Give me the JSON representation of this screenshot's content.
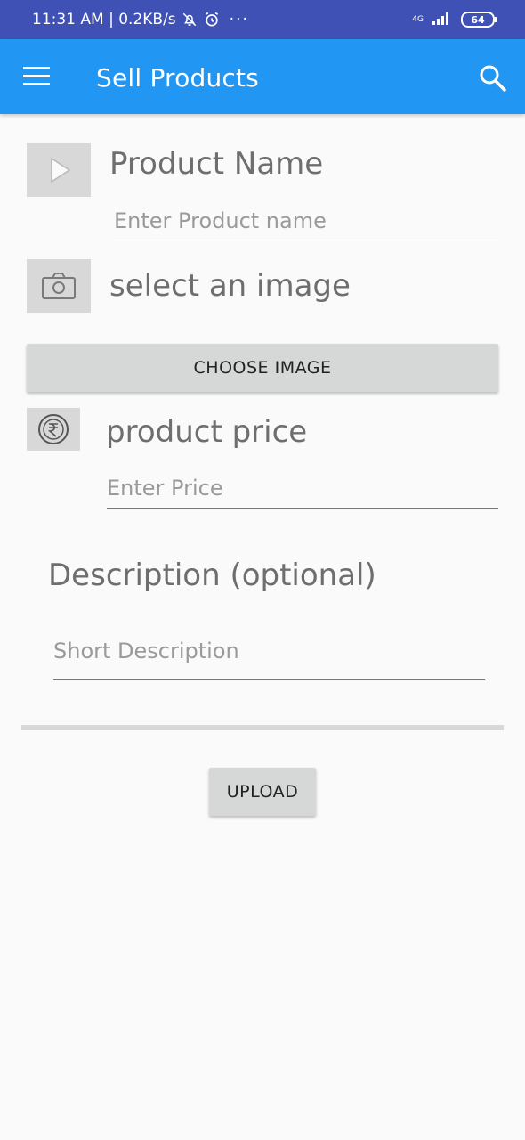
{
  "status_bar": {
    "time": "11:31 AM | 0.2KB/s",
    "more": "···",
    "network": "4G",
    "battery": "64",
    "icons": [
      "bell-off-icon",
      "alarm-icon",
      "signal-icon",
      "battery-icon"
    ]
  },
  "app_bar": {
    "title": "Sell Products",
    "icons": [
      "menu-icon",
      "search-icon"
    ],
    "color": "#2196f3",
    "status_color": "#3f51b5"
  },
  "form": {
    "product_name": {
      "label": "Product Name",
      "placeholder": "Enter Product name",
      "icon": "play-icon"
    },
    "image": {
      "label": "select an image",
      "icon": "camera-icon",
      "button_label": "CHOOSE IMAGE"
    },
    "price": {
      "label": "product price",
      "placeholder": "Enter Price",
      "icon": "rupee-icon"
    },
    "description": {
      "label": "Description (optional)",
      "placeholder": "Short Description"
    },
    "upload_label": "UPLOAD"
  }
}
